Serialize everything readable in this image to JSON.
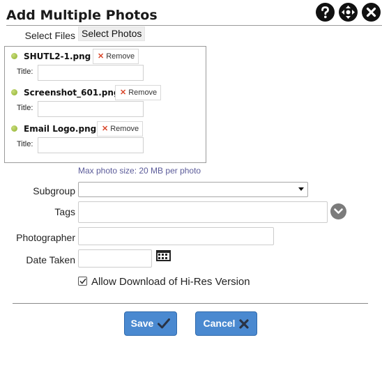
{
  "dialog": {
    "title": "Add Multiple Photos",
    "icons": [
      "help-icon",
      "move-icon",
      "close-icon"
    ]
  },
  "select_files": {
    "label": "Select Files",
    "button": "Select Photos"
  },
  "files": [
    {
      "name": "SHUTL2-1.png",
      "remove": "Remove",
      "title_label": "Title:",
      "title_value": ""
    },
    {
      "name": "Screenshot_601.png",
      "remove": "Remove",
      "title_label": "Title:",
      "title_value": ""
    },
    {
      "name": "Email Logo.png",
      "remove": "Remove",
      "title_label": "Title:",
      "title_value": ""
    }
  ],
  "max_size_note": "Max photo size: 20 MB per photo",
  "form": {
    "subgroup_label": "Subgroup",
    "subgroup_value": "",
    "tags_label": "Tags",
    "tags_value": "",
    "photographer_label": "Photographer",
    "photographer_value": "",
    "date_taken_label": "Date Taken",
    "date_taken_value": "",
    "allow_download_label": "Allow Download of Hi-Res Version",
    "allow_download_checked": true
  },
  "buttons": {
    "save": "Save",
    "cancel": "Cancel"
  },
  "colors": {
    "primary_button": "#4a89d0",
    "status_dot": "#8fb02e",
    "remove_x": "#d9472b",
    "note_text": "#5b5b99"
  }
}
